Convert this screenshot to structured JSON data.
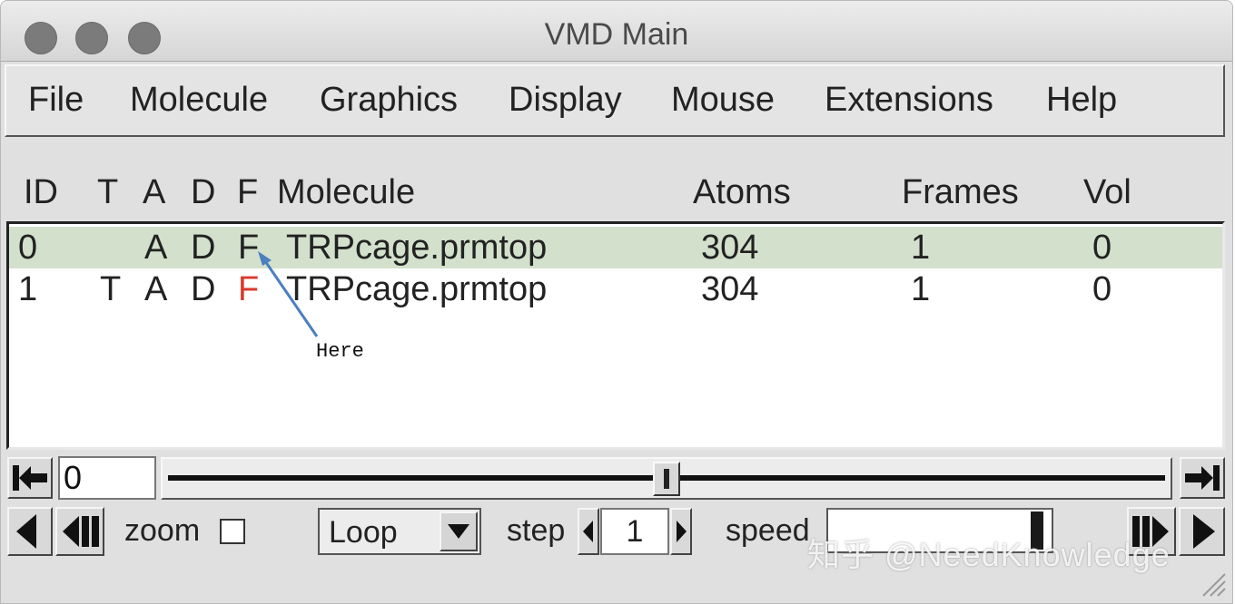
{
  "window": {
    "title": "VMD Main"
  },
  "menu": [
    "File",
    "Molecule",
    "Graphics",
    "Display",
    "Mouse",
    "Extensions",
    "Help"
  ],
  "columns": [
    "ID",
    "T",
    "A",
    "D",
    "F",
    "Molecule",
    "Atoms",
    "Frames",
    "Vol"
  ],
  "rows": [
    {
      "id": "0",
      "t": "",
      "a": "A",
      "d": "D",
      "f": "F",
      "molecule": "TRPcage.prmtop",
      "atoms": "304",
      "frames": "1",
      "vol": "0",
      "selected": true
    },
    {
      "id": "1",
      "t": "T",
      "a": "A",
      "d": "D",
      "f": "F",
      "molecule": "TRPcage.prmtop",
      "atoms": "304",
      "frames": "1",
      "vol": "0",
      "f_color": "#d93a2b"
    }
  ],
  "annotation": {
    "text": "Here",
    "color": "#4a7fc0"
  },
  "animation": {
    "frame_value": "0",
    "slider_position": 0.5,
    "zoom_label": "zoom",
    "zoom_checked": false,
    "loop_mode": "Loop",
    "step_label": "step",
    "step_value": "1",
    "speed_label": "speed",
    "speed_level": 0.96
  },
  "watermark": "知乎 @NeedKnowledge",
  "icons": [
    "jump-to-start-icon",
    "jump-to-end-icon",
    "play-reverse-icon",
    "step-back-icon",
    "step-forward-icon",
    "play-forward-icon",
    "dropdown-arrow-icon",
    "step-decrement-icon",
    "step-increment-icon",
    "resize-grip-icon"
  ]
}
